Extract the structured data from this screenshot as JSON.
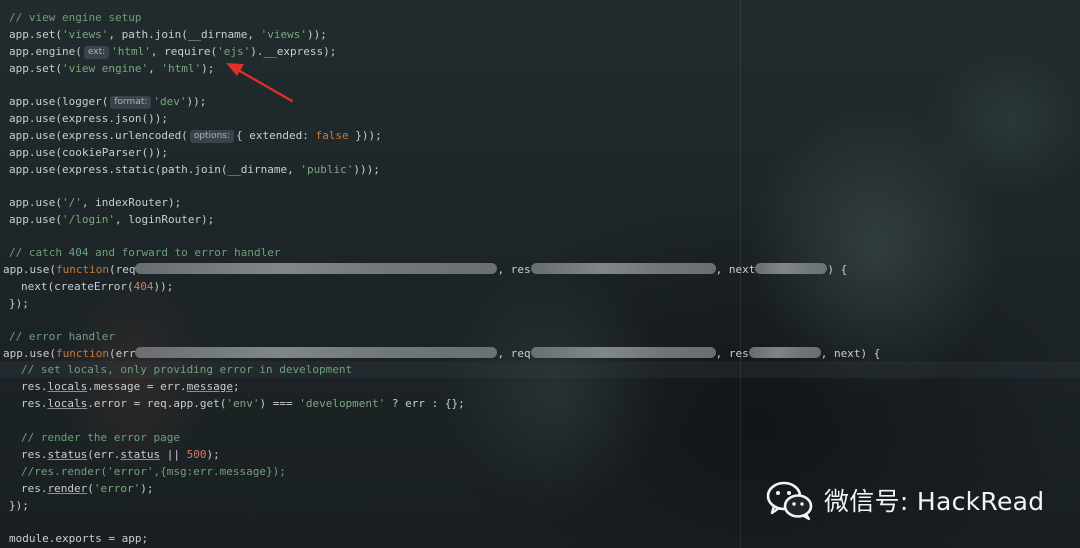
{
  "editor": {
    "lines": {
      "l1": "// view engine setup",
      "l2a": "app.set(",
      "l2b": "'views'",
      "l2c": ", path.join(__dirname, ",
      "l2d": "'views'",
      "l2e": "));",
      "l3a": "app.engine(",
      "l3hint": "ext:",
      "l3b": "'html'",
      "l3c": ", require(",
      "l3d": "'ejs'",
      "l3e": ").__express);",
      "l4a": "app.set(",
      "l4b": "'view engine'",
      "l4c": ", ",
      "l4d": "'html'",
      "l4e": ");",
      "l5a": "app.use(logger(",
      "l5hint": "format:",
      "l5b": "'dev'",
      "l5c": "));",
      "l6": "app.use(express.json());",
      "l7a": "app.use(express.urlencoded(",
      "l7hint": "options:",
      "l7b": "{ extended: ",
      "l7c": "false",
      "l7d": " }));",
      "l8": "app.use(cookieParser());",
      "l9a": "app.use(express.static(path.join(__dirname, ",
      "l9b": "'public'",
      "l9c": ")));",
      "l10a": "app.use(",
      "l10b": "'/'",
      "l10c": ", indexRouter);",
      "l11a": "app.use(",
      "l11b": "'/login'",
      "l11c": ", loginRouter);",
      "l12": "// catch 404 and forward to error handler",
      "l13a": "app.use(",
      "l13b": "function",
      "l13c": "(req",
      "l13d": ", res",
      "l13e": ", next",
      "l13f": ") {",
      "l14a": "next(createError(",
      "l14b": "404",
      "l14c": "));",
      "l15": "});",
      "l16": "// error handler",
      "l17a": "app.use(",
      "l17b": "function",
      "l17c": "(err",
      "l17d": ", req",
      "l17e": ", res",
      "l17f": ", next) {",
      "l18": "// set locals, only providing error in development",
      "l19a": "res.",
      "l19b": "locals",
      "l19c": ".message = err.",
      "l19d": "message",
      "l19e": ";",
      "l20a": "res.",
      "l20b": "locals",
      "l20c": ".error = req.app.get(",
      "l20d": "'env'",
      "l20e": ") === ",
      "l20f": "'development'",
      "l20g": " ? err : {};",
      "l21": "// render the error page",
      "l22a": "res.",
      "l22b": "status",
      "l22c": "(err.",
      "l22d": "status",
      "l22e": " || ",
      "l22f": "500",
      "l22g": ");",
      "l23": "//res.render('error',{msg:err.message});",
      "l24a": "res.",
      "l24b": "render",
      "l24c": "(",
      "l24d": "'error'",
      "l24e": ");",
      "l25": "});",
      "l26": "module.exports = app;"
    }
  },
  "watermark": {
    "text": "微信号: HackRead",
    "icon": "wechat-icon"
  },
  "colors": {
    "annotation_arrow": "#e0302a",
    "comment": "#6f9f7a",
    "string": "#79a87e",
    "keyword": "#cc7832",
    "number": "#d27c6a"
  }
}
